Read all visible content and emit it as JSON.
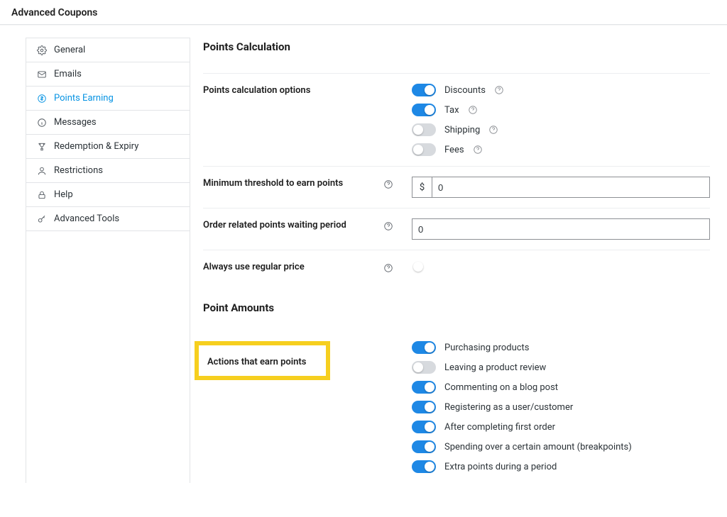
{
  "header": {
    "title": "Advanced Coupons"
  },
  "sidebar": {
    "items": [
      {
        "label": "General"
      },
      {
        "label": "Emails"
      },
      {
        "label": "Points Earning"
      },
      {
        "label": "Messages"
      },
      {
        "label": "Redemption & Expiry"
      },
      {
        "label": "Restrictions"
      },
      {
        "label": "Help"
      },
      {
        "label": "Advanced Tools"
      }
    ]
  },
  "sections": {
    "points_calculation": {
      "title": "Points Calculation",
      "options_label": "Points calculation options",
      "min_threshold_label": "Minimum threshold to earn points",
      "waiting_period_label": "Order related points waiting period",
      "regular_price_label": "Always use regular price",
      "currency_symbol": "$",
      "min_threshold_value": "0",
      "waiting_period_value": "0",
      "calc_options": [
        {
          "label": "Discounts",
          "on": true,
          "help": true
        },
        {
          "label": "Tax",
          "on": true,
          "help": true
        },
        {
          "label": "Shipping",
          "on": false,
          "help": true
        },
        {
          "label": "Fees",
          "on": false,
          "help": true
        }
      ]
    },
    "point_amounts": {
      "title": "Point Amounts",
      "actions_label": "Actions that earn points",
      "actions": [
        {
          "label": "Purchasing products",
          "on": true
        },
        {
          "label": "Leaving a product review",
          "on": false
        },
        {
          "label": "Commenting on a blog post",
          "on": true
        },
        {
          "label": "Registering as a user/customer",
          "on": true
        },
        {
          "label": "After completing first order",
          "on": true
        },
        {
          "label": "Spending over a certain amount (breakpoints)",
          "on": true
        },
        {
          "label": "Extra points during a period",
          "on": true
        }
      ]
    }
  }
}
